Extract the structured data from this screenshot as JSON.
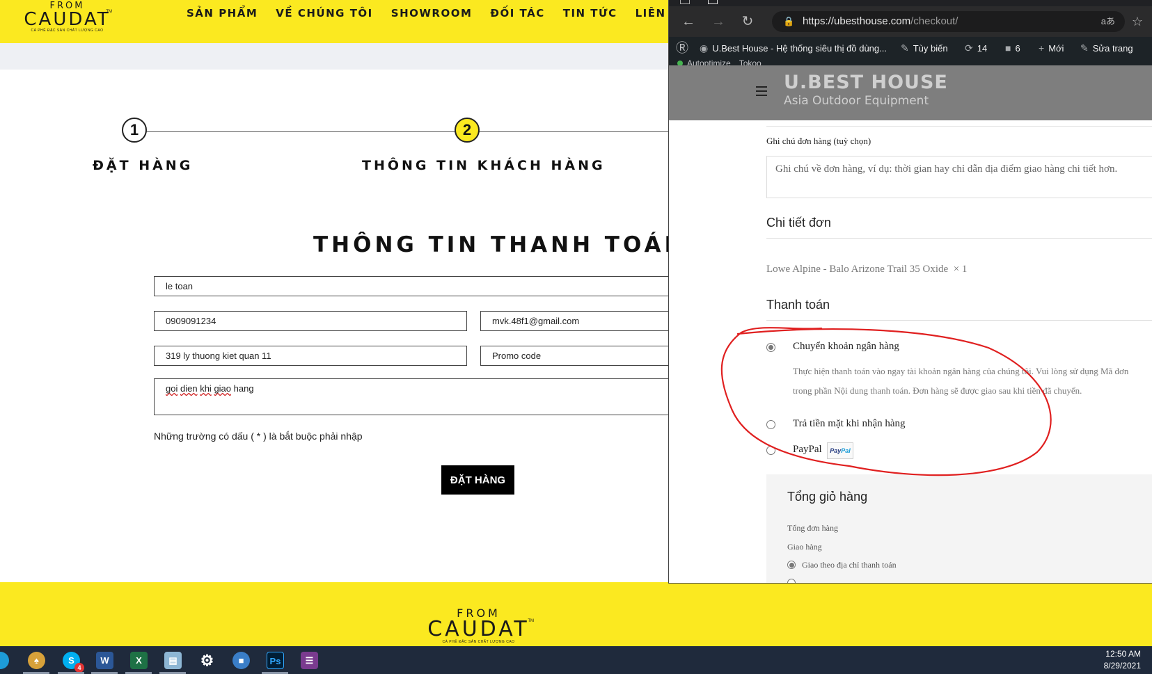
{
  "site": {
    "logo": {
      "from": "FROM",
      "name": "CAUDAT",
      "tm": "TM",
      "tagline": "CÀ PHÊ ĐẶC SẢN CHẤT LƯỢNG CAO"
    },
    "nav": [
      "SẢN PHẨM",
      "VỀ CHÚNG TÔI",
      "SHOWROOM",
      "ĐỐI TÁC",
      "TIN TỨC",
      "LIÊN HỆ"
    ],
    "steps": [
      {
        "number": "1",
        "label": "ĐẶT HÀNG"
      },
      {
        "number": "2",
        "label": "THÔNG TIN KHÁCH HÀNG"
      }
    ],
    "form": {
      "title": "THÔNG TIN THANH TOÁN",
      "name": "le toan",
      "phone": "0909091234",
      "email": "mvk.48f1@gmail.com",
      "address": "319 ly thuong kiet quan 11",
      "promo_placeholder": "Promo code",
      "note_parts": [
        "goi",
        " ",
        "dien",
        " ",
        "khi",
        " ",
        "giao",
        " hang"
      ],
      "required_note": "Những trường có dấu ( * ) là bắt buộc phải nhập",
      "submit": "ĐẶT HÀNG"
    }
  },
  "browser": {
    "url_host": "https://ubesthouse.com",
    "url_path": "/checkout/",
    "toolbar_icons": [
      "back-icon",
      "forward-icon",
      "reload-icon",
      "lock-icon",
      "read-aloud-icon",
      "favorites-icon"
    ],
    "aa_label": "aあ",
    "wp_bar": {
      "site_title": "U.Best House - Hệ thống siêu thị đồ dùng...",
      "customize": "Tùy biến",
      "updates": "14",
      "comments": "6",
      "new": "Mới",
      "edit": "Sửa trang",
      "autoptimize": "Autoptimize",
      "tokoo": "Tokoo"
    },
    "site_logo": {
      "line1": "U.BEST HOUSE",
      "line2": "Asia Outdoor Equipment"
    },
    "checkout": {
      "notes_label": "Ghi chú đơn hàng (tuỳ chọn)",
      "notes_placeholder": "Ghi chú về đơn hàng, ví dụ: thời gian hay chỉ dẫn địa điểm giao hàng chi tiết hơn.",
      "order_details_heading": "Chi tiết đơn",
      "item": "Lowe Alpine - Balo Arizone Trail 35 Oxide",
      "item_qty": "× 1",
      "payment_heading": "Thanh toán",
      "bank_transfer": "Chuyển khoản ngân hàng",
      "bank_desc_1": "Thực hiện thanh toán vào ngay tài khoản ngân hàng của chúng tôi. Vui lòng sử dụng Mã đơn",
      "bank_desc_2": "trong phần Nội dung thanh toán. Đơn hàng sẽ được giao sau khi tiền đã chuyển.",
      "cod": "Trả tiền mặt khi nhận hàng",
      "paypal": "PayPal",
      "paypal_badge_a": "Pay",
      "paypal_badge_b": "Pal",
      "selected_payment": "Chuyển khoản ngân hàng",
      "cart_totals_heading": "Tổng giỏ hàng",
      "subtotal_label": "Tổng đơn hàng",
      "shipping_label": "Giao hàng",
      "shipping_option": "Giao theo địa chỉ thanh toán"
    }
  },
  "taskbar": {
    "apps": [
      "chrome-icon",
      "skype-icon",
      "word-icon",
      "excel-icon",
      "notepad-icon",
      "settings-icon",
      "remote-icon",
      "photoshop-icon",
      "winrar-icon"
    ],
    "skype_badge": "4",
    "time": "12:50 AM",
    "date": "8/29/2021"
  },
  "colors": {
    "brand_yellow": "#fbe920",
    "annotation_red": "#e02020",
    "wp_bar": "#1d2327"
  }
}
